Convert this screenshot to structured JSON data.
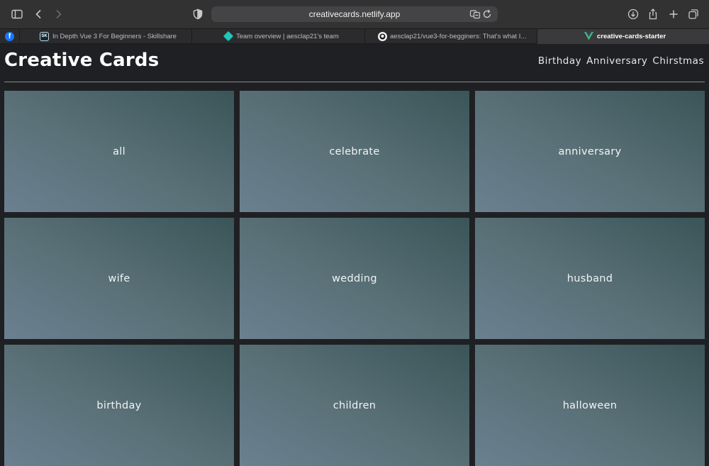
{
  "browser": {
    "url": "creativecards.netlify.app",
    "tabs": [
      {
        "label": "",
        "favicon": "facebook-icon"
      },
      {
        "label": "In Depth Vue 3 For Beginners - Skillshare",
        "favicon": "skillshare-icon"
      },
      {
        "label": "Team overview | aesclap21's team",
        "favicon": "netlify-icon"
      },
      {
        "label": "aesclap21/vue3-for-begginers: That's what I...",
        "favicon": "github-icon"
      },
      {
        "label": "creative-cards-starter",
        "favicon": "vue-icon"
      }
    ]
  },
  "site": {
    "title": "Creative Cards",
    "nav": [
      "Birthday",
      "Anniversary",
      "Chirstmas"
    ]
  },
  "cards": [
    "all",
    "celebrate",
    "anniversary",
    "wife",
    "wedding",
    "husband",
    "birthday",
    "children",
    "halloween"
  ]
}
